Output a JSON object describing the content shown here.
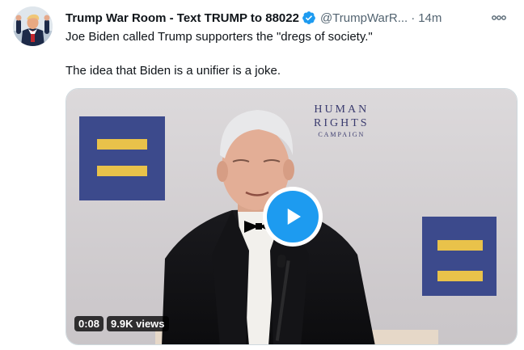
{
  "tweet": {
    "display_name": "Trump War Room - Text TRUMP to 88022",
    "handle": "@TrumpWarR...",
    "separator": "·",
    "time": "14m",
    "text_line1": "Joe Biden called Trump supporters the \"dregs of society.\"",
    "text_line2": "The idea that Biden is a unifier is a joke."
  },
  "icons": {
    "verified": "verified-badge-icon",
    "more": "more-options-icon",
    "play": "play-icon"
  },
  "video": {
    "duration": "0:08",
    "views": "9.9K views",
    "backdrop_logo": {
      "line1": "HUMAN",
      "line2": "RIGHTS",
      "line3": "CAMPAIGN"
    }
  },
  "colors": {
    "accent": "#1d9bf0",
    "text_primary": "#0f1419",
    "text_secondary": "#536471",
    "hrc_blue": "#3c4a8c",
    "hrc_yellow": "#e9c24a"
  }
}
